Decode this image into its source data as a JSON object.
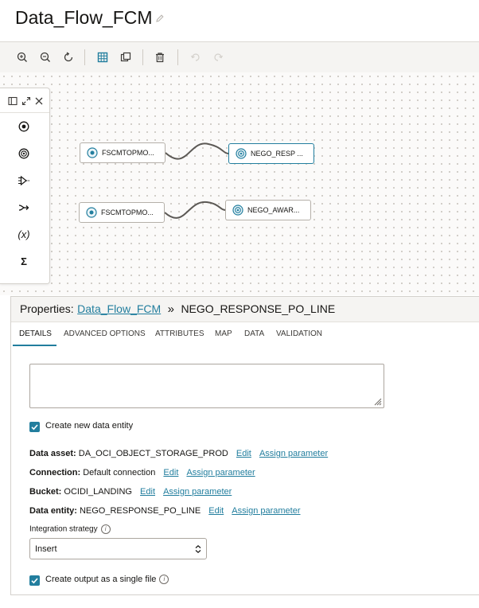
{
  "header": {
    "title": "Data_Flow_FCM"
  },
  "toolbar": {
    "buttons": [
      "zoom-in",
      "zoom-out",
      "reset-zoom",
      "grid",
      "duplicate",
      "delete",
      "undo",
      "redo"
    ]
  },
  "palette": {
    "items": [
      {
        "name": "source",
        "glyph": "⦿"
      },
      {
        "name": "target",
        "glyph": "◎"
      },
      {
        "name": "filter",
        "glyph": "⊳"
      },
      {
        "name": "join",
        "glyph": "⤳"
      },
      {
        "name": "expression",
        "glyph": "(x)"
      },
      {
        "name": "aggregate",
        "glyph": "Σ"
      }
    ]
  },
  "canvas": {
    "nodes": [
      {
        "label": "FSCMTOPMO...",
        "kind": "source"
      },
      {
        "label": "NEGO_RESP ...",
        "kind": "target",
        "selected": true
      },
      {
        "label": "FSCMTOPMO...",
        "kind": "source"
      },
      {
        "label": "NEGO_AWAR...",
        "kind": "target"
      }
    ]
  },
  "properties": {
    "prefix": "Properties:",
    "crumb_link": "Data_Flow_FCM",
    "separator": "»",
    "crumb_current": "NEGO_RESPONSE_PO_LINE",
    "tabs": [
      "DETAILS",
      "ADVANCED OPTIONS",
      "ATTRIBUTES",
      "MAP",
      "DATA",
      "VALIDATION"
    ],
    "active_tab": "DETAILS",
    "create_entity_label": "Create new data entity",
    "create_entity_checked": true,
    "data_asset": {
      "label": "Data asset:",
      "value": "DA_OCI_OBJECT_STORAGE_PROD",
      "edit": "Edit",
      "assign": "Assign parameter"
    },
    "connection": {
      "label": "Connection:",
      "value": "Default connection",
      "edit": "Edit",
      "assign": "Assign parameter"
    },
    "bucket": {
      "label": "Bucket:",
      "value": "OCIDI_LANDING",
      "edit": "Edit",
      "assign": "Assign parameter"
    },
    "data_entity": {
      "label": "Data entity:",
      "value": "NEGO_RESPONSE_PO_LINE",
      "edit": "Edit",
      "assign": "Assign parameter"
    },
    "integration_strategy_label": "Integration strategy",
    "integration_strategy_value": "Insert",
    "single_file_label": "Create output as a single file",
    "single_file_checked": true
  },
  "colors": {
    "accent": "#227e9e",
    "text": "#161513",
    "canvas_bg": "#fbfaf9"
  }
}
